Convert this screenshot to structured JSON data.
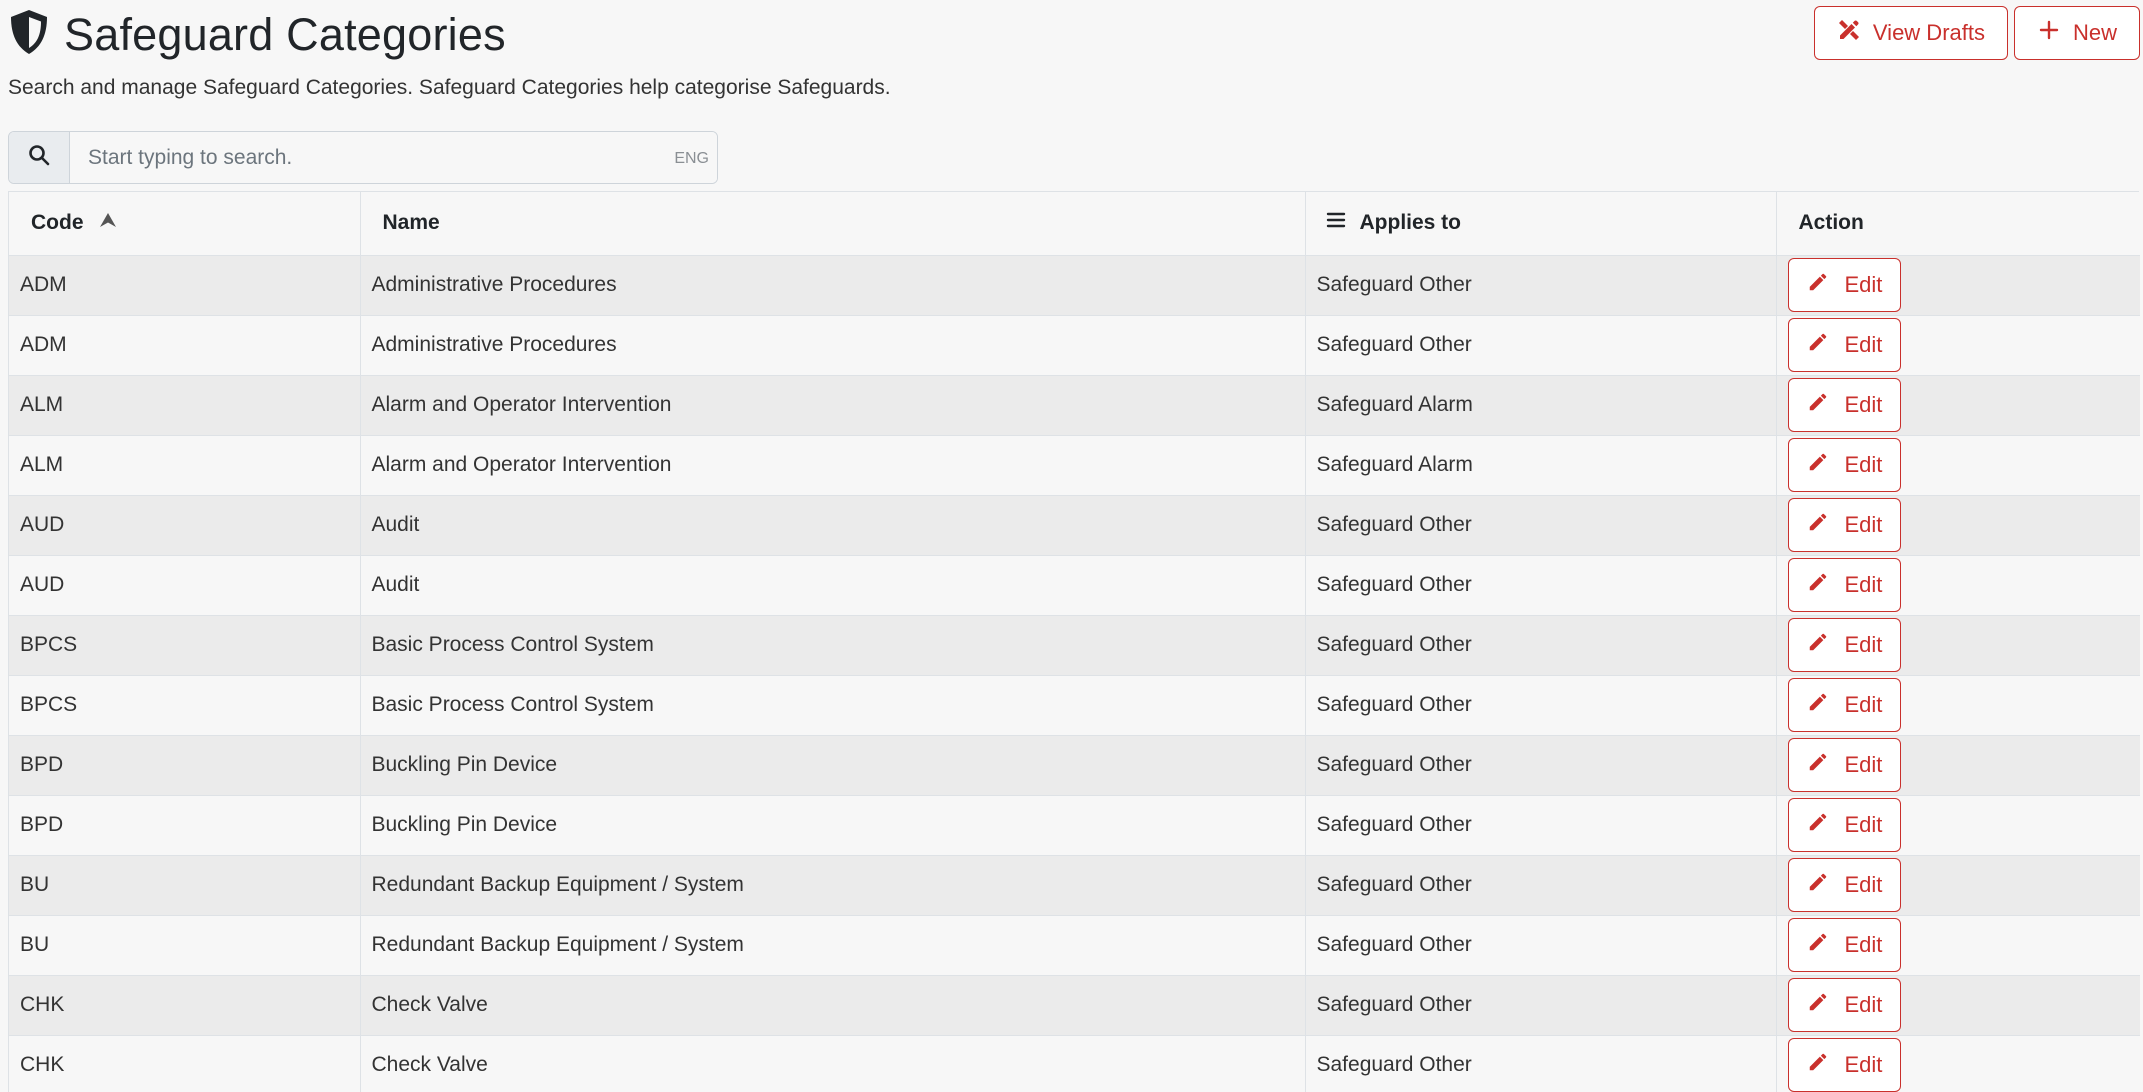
{
  "header": {
    "title": "Safeguard Categories",
    "title_icon": "shield-icon",
    "subtitle": "Search and manage Safeguard Categories. Safeguard Categories help categorise Safeguards.",
    "view_drafts_label": "View Drafts",
    "view_drafts_icon": "pencil-ruler-icon",
    "new_label": "New",
    "new_icon": "plus-icon"
  },
  "search": {
    "placeholder": "Start typing to search.",
    "value": "",
    "lang": "ENG",
    "icon": "search-icon"
  },
  "table": {
    "columns": {
      "code": "Code",
      "name": "Name",
      "applies_to": "Applies to",
      "action": "Action"
    },
    "sort": {
      "column": "code",
      "direction": "ascending"
    },
    "edit_label": "Edit",
    "rows": [
      {
        "code": "ADM",
        "name": "Administrative Procedures",
        "applies_to": "Safeguard Other"
      },
      {
        "code": "ADM",
        "name": "Administrative Procedures",
        "applies_to": "Safeguard Other"
      },
      {
        "code": "ALM",
        "name": "Alarm and Operator Intervention",
        "applies_to": "Safeguard Alarm"
      },
      {
        "code": "ALM",
        "name": "Alarm and Operator Intervention",
        "applies_to": "Safeguard Alarm"
      },
      {
        "code": "AUD",
        "name": "Audit",
        "applies_to": "Safeguard Other"
      },
      {
        "code": "AUD",
        "name": "Audit",
        "applies_to": "Safeguard Other"
      },
      {
        "code": "BPCS",
        "name": "Basic Process Control System",
        "applies_to": "Safeguard Other"
      },
      {
        "code": "BPCS",
        "name": "Basic Process Control System",
        "applies_to": "Safeguard Other"
      },
      {
        "code": "BPD",
        "name": "Buckling Pin Device",
        "applies_to": "Safeguard Other"
      },
      {
        "code": "BPD",
        "name": "Buckling Pin Device",
        "applies_to": "Safeguard Other"
      },
      {
        "code": "BU",
        "name": "Redundant Backup Equipment / System",
        "applies_to": "Safeguard Other"
      },
      {
        "code": "BU",
        "name": "Redundant Backup Equipment / System",
        "applies_to": "Safeguard Other"
      },
      {
        "code": "CHK",
        "name": "Check Valve",
        "applies_to": "Safeguard Other"
      },
      {
        "code": "CHK",
        "name": "Check Valve",
        "applies_to": "Safeguard Other"
      }
    ]
  },
  "colors": {
    "accent": "#c9302c",
    "background": "#f7f7f7",
    "row_striped": "#ebebeb"
  }
}
